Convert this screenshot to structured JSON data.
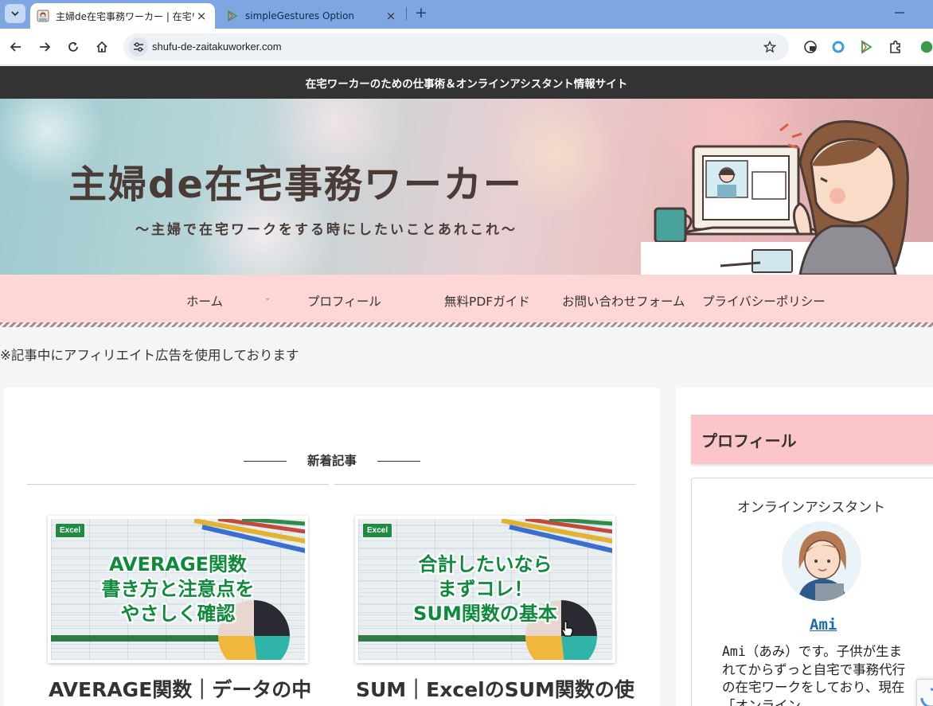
{
  "browser": {
    "tabs": [
      {
        "title": "主婦de在宅事務ワーカー | 在宅ワ",
        "active": true
      },
      {
        "title": "simpleGestures Option",
        "active": false
      }
    ],
    "new_tab_label": "+",
    "tab_close_label": "×",
    "url": "shufu-de-zaitakuworker.com",
    "accent": "#7fa6e0"
  },
  "page": {
    "topbar_text": "在宅ワーカーのための仕事術＆オンラインアシスタント情報サイト",
    "site_title": "主婦de在宅事務ワーカー",
    "site_tagline": "〜主婦で在宅ワークをする時にしたいことあれこれ〜",
    "nav": {
      "items": [
        "ホーム",
        "プロフィール",
        "無料PDFガイド",
        "お問い合わせフォーム",
        "プライバシーポリシー"
      ],
      "chevron": "⌄",
      "background": "#fdd6d6"
    },
    "affiliate_notice": "※記事中にアフィリエイト広告を使用しております",
    "latest": {
      "heading": "新着記事",
      "cards": [
        {
          "badge": "Excel",
          "thumb_lines": [
            "AVERAGE関数",
            "書き方と注意点を",
            "やさしく確認"
          ],
          "title": "AVERAGE関数｜データの中"
        },
        {
          "badge": "Excel",
          "thumb_lines": [
            "合計したいなら",
            "まずコレ！",
            "SUM関数の基本"
          ],
          "title": "SUM｜ExcelのSUM関数の使"
        }
      ]
    },
    "sidebar": {
      "heading": "プロフィール",
      "role": "オンラインアシスタント",
      "name": "Ami",
      "bio": "Ami（あみ）です。子供が生まれてからずっと自宅で事務代行の在宅ワークをしており、現在「オンライン"
    }
  }
}
